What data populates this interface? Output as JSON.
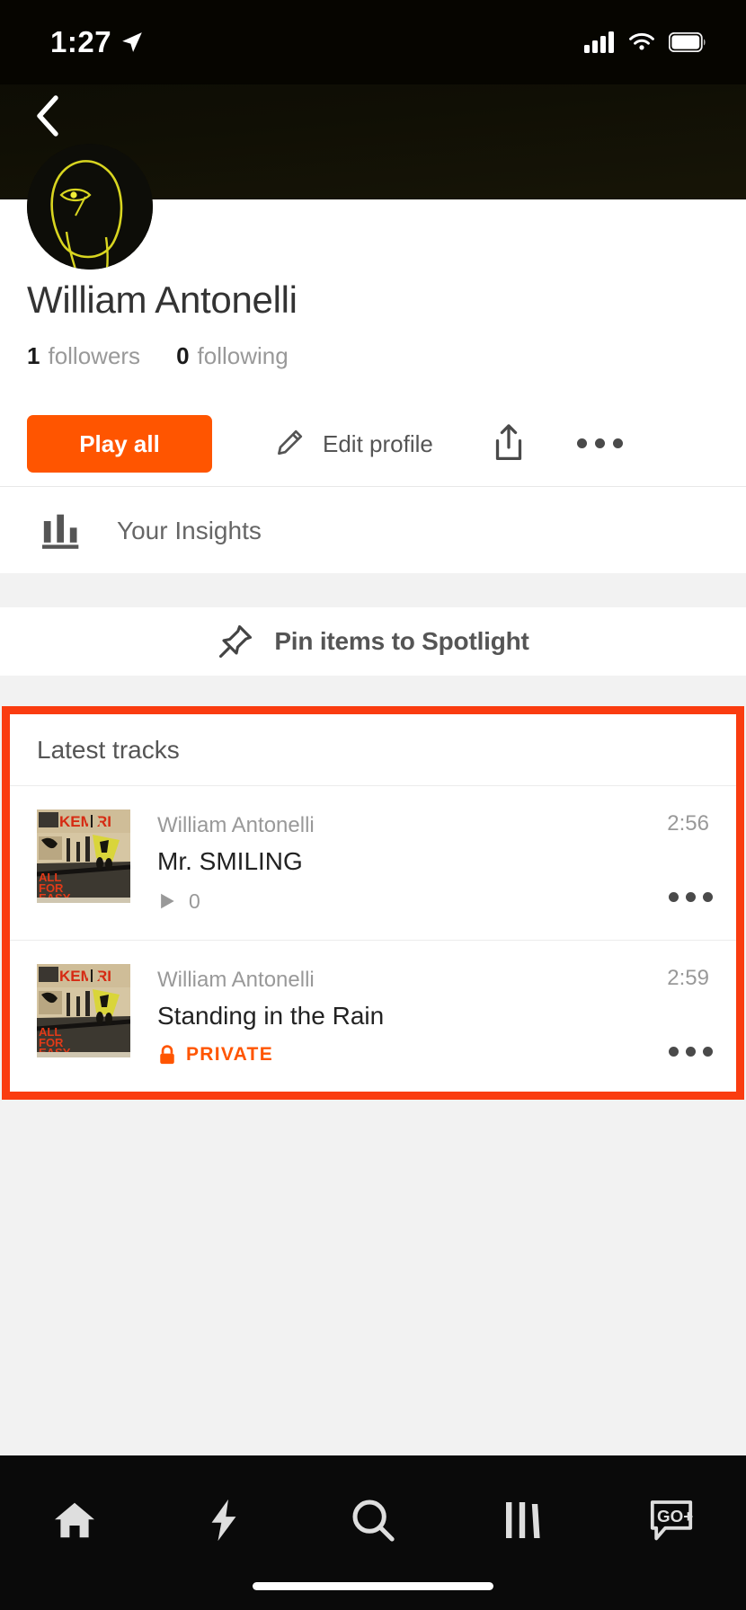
{
  "status_bar": {
    "time": "1:27",
    "location_icon": "location-arrow-icon",
    "signal_icon": "cellular-signal-icon",
    "wifi_icon": "wifi-icon",
    "battery_icon": "battery-icon"
  },
  "header": {
    "back_icon": "chevron-left-icon",
    "avatar_alt": "profile-avatar"
  },
  "profile": {
    "display_name": "William Antonelli",
    "followers_count": "1",
    "followers_label": "followers",
    "following_count": "0",
    "following_label": "following"
  },
  "actions": {
    "play_all_label": "Play all",
    "edit_profile_label": "Edit profile",
    "edit_icon": "pencil-icon",
    "share_icon": "share-upload-icon",
    "more_icon": "ellipsis-icon"
  },
  "insights": {
    "label": "Your Insights",
    "icon": "bar-chart-icon"
  },
  "spotlight": {
    "label": "Pin items to Spotlight",
    "icon": "pin-icon"
  },
  "latest_tracks": {
    "section_title": "Latest tracks",
    "highlight_color": "#fa3c10",
    "accent_color": "#ff5500",
    "tracks": [
      {
        "artist": "William Antonelli",
        "title": "Mr. SMILING",
        "duration": "2:56",
        "play_count": "0",
        "play_icon": "play-triangle-icon",
        "artwork_alt": "kemuri-album-artwork",
        "artwork_text": "KEMURI",
        "private": false,
        "more_icon": "ellipsis-icon"
      },
      {
        "artist": "William Antonelli",
        "title": "Standing in the Rain",
        "duration": "2:59",
        "play_count": "",
        "play_icon": "",
        "artwork_alt": "kemuri-album-artwork",
        "artwork_text": "KEMURI",
        "private": true,
        "private_label": "PRIVATE",
        "lock_icon": "lock-icon",
        "more_icon": "ellipsis-icon"
      }
    ]
  },
  "tabbar": {
    "items": [
      {
        "name": "home",
        "icon": "home-icon"
      },
      {
        "name": "feed",
        "icon": "lightning-bolt-icon"
      },
      {
        "name": "search",
        "icon": "search-icon"
      },
      {
        "name": "library",
        "icon": "library-icon"
      },
      {
        "name": "upload",
        "icon": "go-plus-icon",
        "label": "GO+"
      }
    ]
  }
}
